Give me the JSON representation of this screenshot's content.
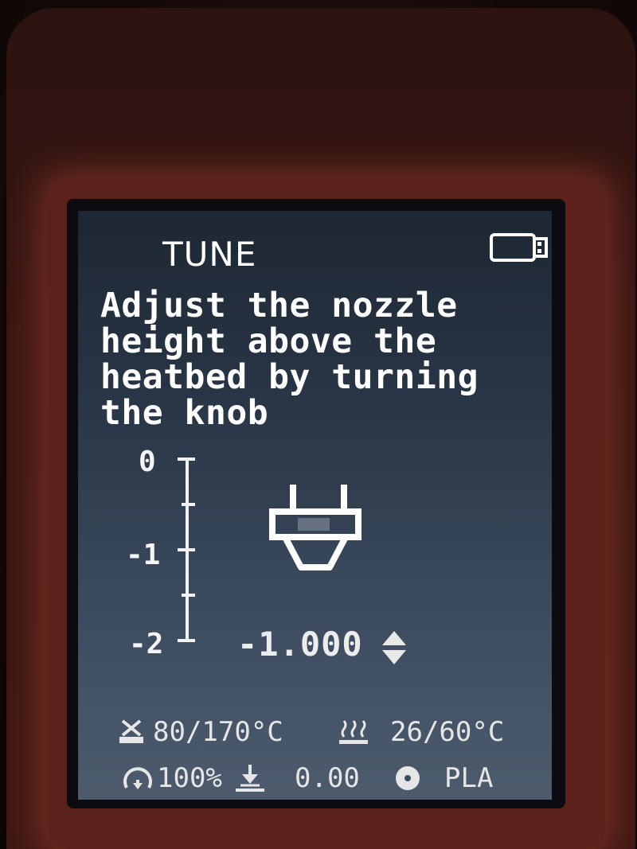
{
  "header": {
    "title": "TUNE",
    "media_icon": "usb-drive-icon"
  },
  "instructions": {
    "lines": [
      "Adjust the nozzle",
      "height above the",
      "heatbed by turning",
      "the knob"
    ]
  },
  "scale": {
    "labels": [
      "0",
      "-1",
      "-2"
    ],
    "range": [
      0,
      -2
    ],
    "tick_step": 0.5
  },
  "offset": {
    "value": "-1.000",
    "numeric": -1.0,
    "adjust_icon": "up-down-arrows-icon"
  },
  "status": {
    "nozzle_temp": "80/170°C",
    "bed_temp": "26/60°C",
    "speed": "100%",
    "z_height": "0.00",
    "filament": "PLA",
    "icons": {
      "nozzle": "nozzle-temp-icon",
      "bed": "heatbed-icon",
      "speed": "speed-gauge-icon",
      "z": "z-axis-icon",
      "filament": "filament-spool-icon"
    }
  },
  "colors": {
    "text": "#ffffff",
    "status_text": "#e6e6e6",
    "screen_top": "#1e2733",
    "screen_bottom": "#4d5b6d",
    "bezel": "#5a221b"
  }
}
